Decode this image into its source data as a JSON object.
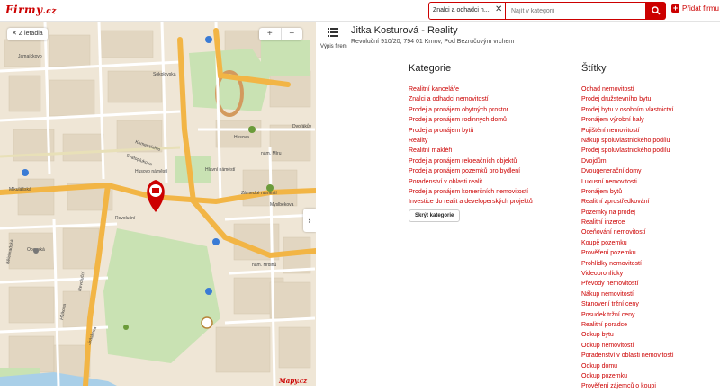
{
  "header": {
    "logo_text": "Firmy",
    "logo_tld": ".cz",
    "search_chip": "Znalci a odhadci n...",
    "search_placeholder": "Najít v kategorii",
    "add_firm_label": "Přidat firmu"
  },
  "map": {
    "back_label": "Z letadla",
    "zoom_in": "+",
    "zoom_out": "−",
    "collapse_glyph": "›",
    "labels": [
      "Komenského",
      "Svatoplukova",
      "Mikulášská",
      "Hlavní náměstí",
      "Husovo náměstí",
      "nám. Míru",
      "Zámecké náměstí",
      "Revoluční",
      "Myslbekova",
      "Jamaíckovo",
      "Sokolovská",
      "nám. Hrdinů",
      "Opavská",
      "Dvořákův",
      "Bělehradská",
      "Hůlkova",
      "Jiráskova",
      "Husova",
      "Revoluční"
    ],
    "logo": "Mapy.cz"
  },
  "firm": {
    "menu_label": "Výpis firem",
    "name": "Jitka Kosturová - Reality",
    "address": "Revoluční 910/20, 794 01 Krnov, Pod Bezručovým vrchem"
  },
  "categories": {
    "title": "Kategorie",
    "items": [
      "Realitní kanceláře",
      "Znalci a odhadci nemovitostí",
      "Prodej a pronájem obytných prostor",
      "Prodej a pronájem rodinných domů",
      "Prodej a pronájem bytů",
      "Reality",
      "Realitní makléři",
      "Prodej a pronájem rekreačních objektů",
      "Prodej a pronájem pozemků pro bydlení",
      "Poradenství v oblasti realit",
      "Prodej a pronájem komerčních nemovitostí",
      "Investice do realit a developerských projektů"
    ],
    "hide_label": "Skrýt kategorie"
  },
  "tags": {
    "title": "Štítky",
    "items": [
      "Odhad nemovitostí",
      "Prodej družstevního bytu",
      "Prodej bytu v osobním vlastnictví",
      "Pronájem výrobní haly",
      "Pojištění nemovitostí",
      "Nákup spoluvlastnického podílu",
      "Prodej spoluvlastnického podílu",
      "Dvojdům",
      "Dvougenerační domy",
      "Luxusní nemovitosti",
      "Pronájem bytů",
      "Realitní zprostředkování",
      "Pozemky na prodej",
      "Realitní inzerce",
      "Oceňování nemovitostí",
      "Koupě pozemku",
      "Prověření pozemku",
      "Prohlídky nemovitostí",
      "Videoprohlídky",
      "Převody nemovitostí",
      "Nákup nemovitostí",
      "Stanovení tržní ceny",
      "Posudek tržní ceny",
      "Realitní poradce",
      "Odkup bytu",
      "Odkup nemovitostí",
      "Poradenství v oblasti nemovitostí",
      "Odkup domu",
      "Odkup pozemku",
      "Prověření zájemců o koupi"
    ]
  },
  "colors": {
    "accent": "#cc0000",
    "map_base": "#efe6d6",
    "road_major": "#f2b545",
    "park": "#c9e2b3",
    "water": "#a9cfe8"
  }
}
